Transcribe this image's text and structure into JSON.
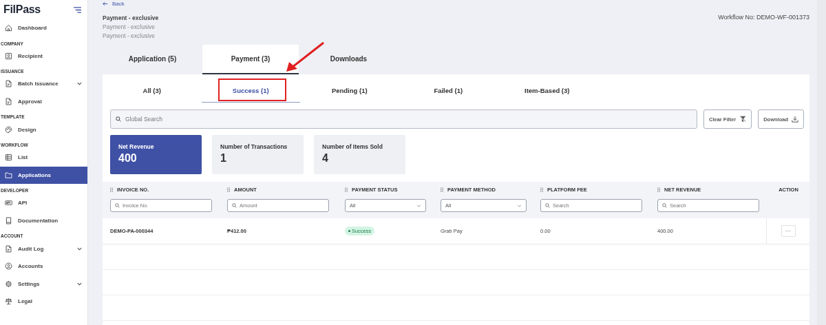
{
  "sidebar": {
    "logo": "FilPass",
    "sections": [
      {
        "items": [
          {
            "label": "Dashboard",
            "expandable": false,
            "selected": false
          }
        ]
      },
      {
        "heading": "COMPANY",
        "items": [
          {
            "label": "Recipient",
            "expandable": false,
            "selected": false
          }
        ]
      },
      {
        "heading": "ISSUANCE",
        "items": [
          {
            "label": "Batch Issuance",
            "expandable": true,
            "selected": false
          },
          {
            "label": "Approval",
            "expandable": false,
            "selected": false
          }
        ]
      },
      {
        "heading": "TEMPLATE",
        "items": [
          {
            "label": "Design",
            "expandable": false,
            "selected": false
          }
        ]
      },
      {
        "heading": "WORKFLOW",
        "items": [
          {
            "label": "List",
            "expandable": false,
            "selected": false
          },
          {
            "label": "Applications",
            "expandable": false,
            "selected": true
          }
        ]
      },
      {
        "heading": "DEVELOPER",
        "items": [
          {
            "label": "API",
            "expandable": false,
            "selected": false
          },
          {
            "label": "Documentation",
            "expandable": false,
            "selected": false
          }
        ]
      },
      {
        "heading": "ACCOUNT",
        "items": [
          {
            "label": "Audit Log",
            "expandable": true,
            "selected": false
          },
          {
            "label": "Accounts",
            "expandable": false,
            "selected": false
          },
          {
            "label": "Settings",
            "expandable": true,
            "selected": false
          },
          {
            "label": "Legal",
            "expandable": false,
            "selected": false
          }
        ]
      }
    ]
  },
  "back": "Back",
  "header": {
    "title": "Payment - exclusive",
    "subtitles": [
      "Payment - exclusive",
      "Payment - exclusive"
    ],
    "workflow_no": "Workflow No: DEMO-WF-001373"
  },
  "tabs": [
    {
      "label": "Application (5)",
      "selected": false
    },
    {
      "label": "Payment (3)",
      "selected": true
    },
    {
      "label": "Downloads",
      "selected": false
    }
  ],
  "subtabs": [
    {
      "label": "All (3)",
      "selected": false
    },
    {
      "label": "Success (1)",
      "selected": true
    },
    {
      "label": "Pending (1)",
      "selected": false
    },
    {
      "label": "Failed (1)",
      "selected": false
    },
    {
      "label": "Item-Based (3)",
      "selected": false
    }
  ],
  "search": {
    "placeholder": "Global Search"
  },
  "buttons": [
    {
      "label": "Clear Filter",
      "kind": "clear-filter"
    },
    {
      "label": "Download",
      "kind": "download"
    }
  ],
  "stats": [
    {
      "label": "Net Revenue",
      "value": "400",
      "selected": true
    },
    {
      "label": "Number of Transactions",
      "value": "1",
      "selected": false
    },
    {
      "label": "Number of Items Sold",
      "value": "4",
      "selected": false
    }
  ],
  "table": {
    "columns": [
      {
        "label": "INVOICE NO.",
        "filter": {
          "kind": "search",
          "placeholder": "Invoice No."
        }
      },
      {
        "label": "AMOUNT",
        "filter": {
          "kind": "search",
          "placeholder": "Amount"
        }
      },
      {
        "label": "PAYMENT STATUS",
        "filter": {
          "kind": "select",
          "value": "All"
        }
      },
      {
        "label": "PAYMENT METHOD",
        "filter": {
          "kind": "select",
          "value": "All"
        }
      },
      {
        "label": "PLATFORM FEE",
        "filter": {
          "kind": "search",
          "placeholder": "Search"
        }
      },
      {
        "label": "NET REVENUE",
        "filter": {
          "kind": "search",
          "placeholder": "Search"
        }
      }
    ],
    "action_label": "ACTION",
    "rows": [
      {
        "cells": [
          "DEMO-PA-000344",
          "₱412.00",
          "Success",
          "Grab Pay",
          "0.00",
          "400.00"
        ],
        "action": "···"
      }
    ]
  }
}
